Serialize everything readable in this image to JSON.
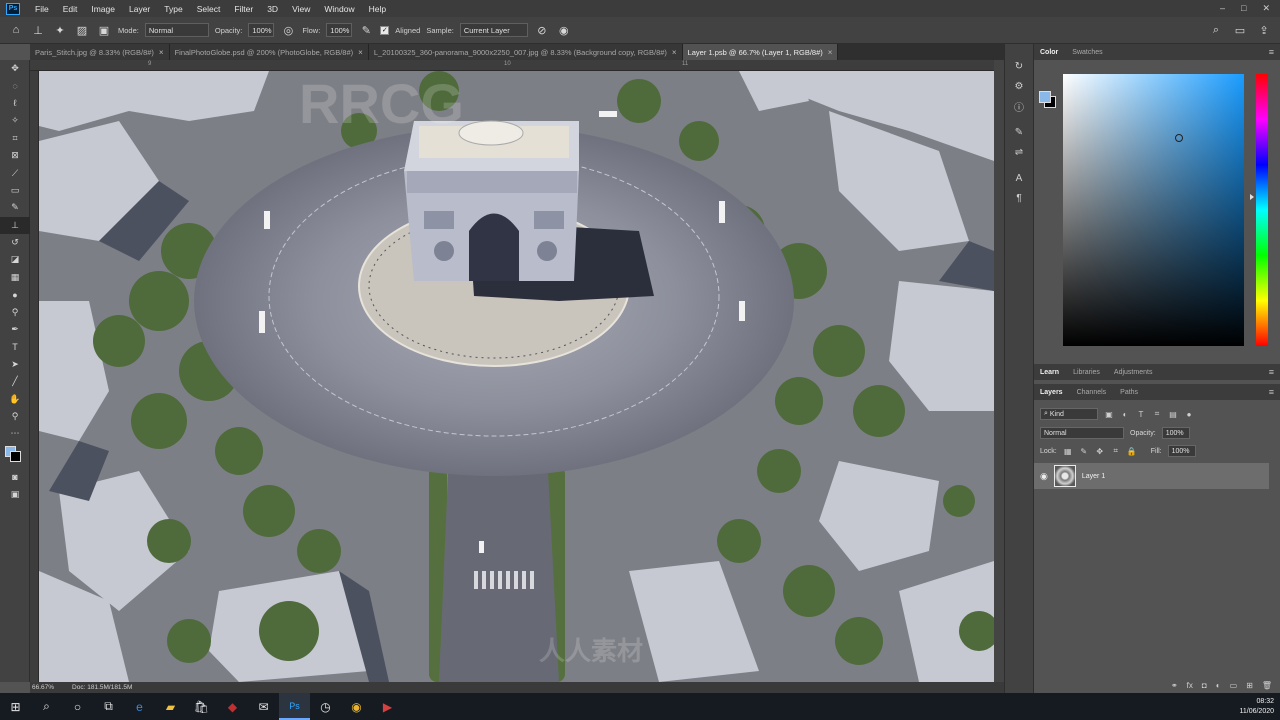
{
  "menu": {
    "logo": "Ps",
    "items": [
      "File",
      "Edit",
      "Image",
      "Layer",
      "Type",
      "Select",
      "Filter",
      "3D",
      "View",
      "Window",
      "Help"
    ]
  },
  "window_controls": [
    "‒",
    "□",
    "✕"
  ],
  "options": {
    "mode_label": "Mode:",
    "mode_value": "Normal",
    "opacity_label": "Opacity:",
    "opacity_value": "100%",
    "flow_label": "Flow:",
    "flow_value": "100%",
    "aligned_label": "Aligned",
    "sample_label": "Sample:",
    "sample_value": "Current Layer"
  },
  "tabs": [
    {
      "label": "Paris_Stitch.jpg @ 8.33% (RGB/8#)"
    },
    {
      "label": "FinalPhotoGlobe.psd @ 200% (PhotoGlobe, RGB/8#)"
    },
    {
      "label": "L_20100325_360-panorama_9000x2250_007.jpg @ 8.33% (Background copy, RGB/8#)"
    },
    {
      "label": "Layer 1.psb @ 66.7% (Layer 1, RGB/8#)"
    }
  ],
  "ruler": {
    "marks": [
      "9",
      "10",
      "11"
    ]
  },
  "status": {
    "zoom": "66.67%",
    "doc": "Doc: 181.5M/181.5M"
  },
  "color_panel": {
    "tabs": [
      "Color",
      "Swatches"
    ],
    "foreground": "#8ab8e8",
    "background": "#000000"
  },
  "learn_tabs": [
    "Learn",
    "Libraries",
    "Adjustments"
  ],
  "layers_tabs": [
    "Layers",
    "Channels",
    "Paths"
  ],
  "layers": {
    "filter_label": "Kind",
    "blend_mode": "Normal",
    "opacity_label": "Opacity:",
    "opacity_value": "100%",
    "lock_label": "Lock:",
    "fill_label": "Fill:",
    "fill_value": "100%",
    "items": [
      {
        "name": "Layer 1",
        "visible": true
      }
    ]
  },
  "taskbar": {
    "time": "08:32",
    "date": "11/06/2020"
  },
  "watermarks": [
    "RRCG",
    "人人素材",
    "RRCG",
    "人人素材"
  ]
}
